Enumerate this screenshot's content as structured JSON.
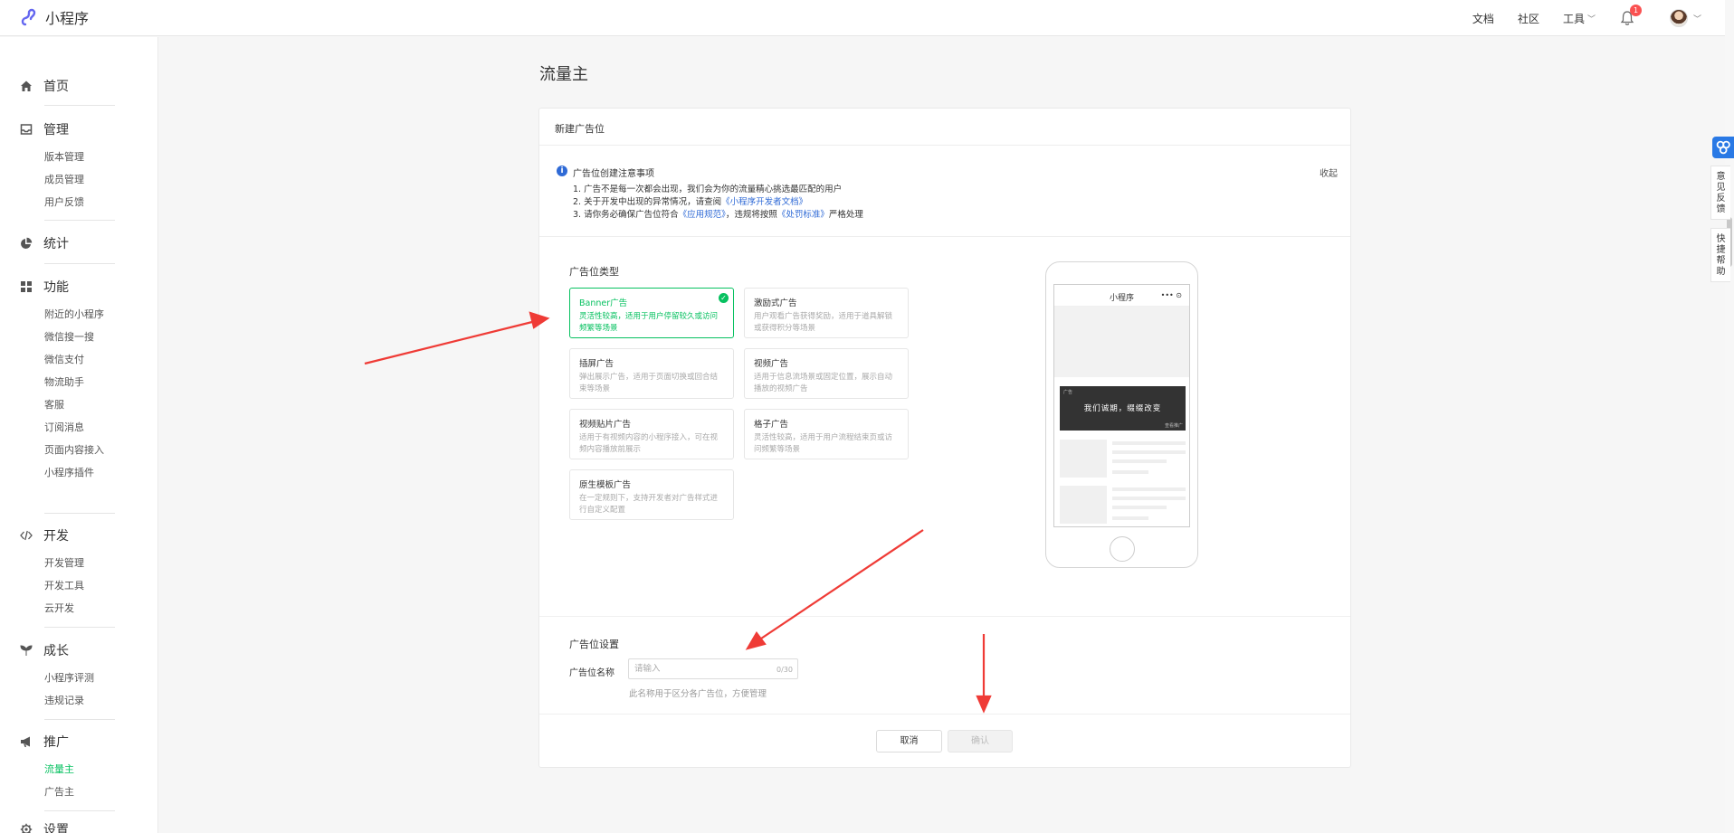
{
  "app": {
    "title": "小程序"
  },
  "topnav": {
    "docs": "文档",
    "community": "社区",
    "tools": "工具",
    "notifications_count": "1"
  },
  "sidebar": {
    "sections": [
      {
        "icon": "home-icon",
        "label": "首页",
        "items": []
      },
      {
        "icon": "inbox-icon",
        "label": "管理",
        "items": [
          "版本管理",
          "成员管理",
          "用户反馈"
        ]
      },
      {
        "icon": "pie-chart-icon",
        "label": "统计",
        "items": []
      },
      {
        "icon": "grid-icon",
        "label": "功能",
        "items": [
          "附近的小程序",
          "微信搜一搜",
          "微信支付",
          "物流助手",
          "客服",
          "订阅消息",
          "页面内容接入",
          "小程序插件"
        ]
      },
      {
        "icon": "code-icon",
        "label": "开发",
        "items": [
          "开发管理",
          "开发工具",
          "云开发"
        ]
      },
      {
        "icon": "sprout-icon",
        "label": "成长",
        "items": [
          "小程序评测",
          "违规记录"
        ]
      },
      {
        "icon": "megaphone-icon",
        "label": "推广",
        "items": [
          "流量主",
          "广告主"
        ]
      },
      {
        "icon": "gear-icon",
        "label": "设置",
        "items": []
      }
    ],
    "active_item": "流量主"
  },
  "page": {
    "title": "流量主"
  },
  "card": {
    "title": "新建广告位"
  },
  "notice": {
    "title": "广告位创建注意事项",
    "collapse": "收起",
    "line1": "1. 广告不是每一次都会出现，我们会为你的流量精心挑选最匹配的用户",
    "line2_prefix": "2. 关于开发中出现的异常情况，请查阅",
    "line2_link": "《小程序开发者文档》",
    "line3_prefix": "3. 请你务必确保广告位符合",
    "line3_link1": "《应用规范》",
    "line3_mid": "，违规将按照",
    "line3_link2": "《处罚标准》",
    "line3_suffix": "严格处理"
  },
  "ad_types": {
    "title": "广告位类型",
    "items": [
      {
        "name": "Banner广告",
        "desc": "灵活性较高，适用于用户停留较久或访问频繁等场景",
        "selected": true
      },
      {
        "name": "激励式广告",
        "desc": "用户观看广告获得奖励，适用于道具解锁或获得积分等场景"
      },
      {
        "name": "插屏广告",
        "desc": "弹出展示广告，适用于页面切换或回合结束等场景"
      },
      {
        "name": "视频广告",
        "desc": "适用于信息流场景或固定位置，展示自动播放的视频广告"
      },
      {
        "name": "视频贴片广告",
        "desc": "适用于有视频内容的小程序接入，可在视频内容播放前展示"
      },
      {
        "name": "格子广告",
        "desc": "灵活性较高，适用于用户流程结束页或访问频繁等场景"
      },
      {
        "name": "原生模板广告",
        "desc": "在一定规则下，支持开发者对广告样式进行自定义配置"
      }
    ]
  },
  "preview": {
    "title": "小程序",
    "capsule": "••• ⊙",
    "banner_tag": "广告",
    "banner_text": "我们诚期，缀缀改变",
    "banner_corner": "查看推广"
  },
  "settings": {
    "title": "广告位设置",
    "name_label": "广告位名称",
    "name_placeholder": "请输入",
    "name_count": "0/30",
    "hint": "此名称用于区分各广告位，方便管理"
  },
  "actions": {
    "cancel": "取消",
    "confirm": "确认"
  },
  "floating": {
    "feedback": "意见反馈",
    "help": "快捷帮助"
  },
  "colors": {
    "accent": "#07c160",
    "link": "#2f6ad6",
    "arrow": "#ef3b36"
  }
}
